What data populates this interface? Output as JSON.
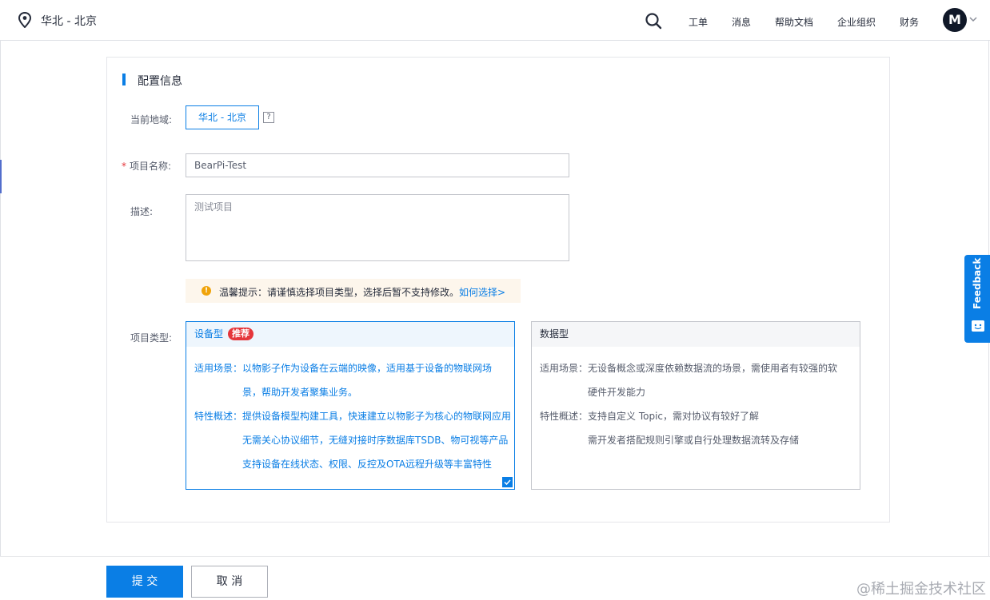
{
  "header": {
    "region": "华北 - 北京",
    "nav": [
      "工单",
      "消息",
      "帮助文档",
      "企业组织",
      "财务"
    ],
    "avatar_letter": "M"
  },
  "form": {
    "section_title": "配置信息",
    "region_label": "当前地域:",
    "region_value": "华北 - 北京",
    "help_mark": "?",
    "name_required_mark": "*",
    "name_label": "项目名称:",
    "name_value": "BearPi-Test",
    "desc_label": "描述:",
    "desc_value": "测试项目",
    "tip_text": "温馨提示：请谨慎选择项目类型，选择后暂不支持修改。",
    "tip_link": "如何选择>",
    "type_label": "项目类型:"
  },
  "types": [
    {
      "title": "设备型",
      "badge": "推荐",
      "selected": true,
      "lines": [
        "适用场景：以物影子作为设备在云端的映像，适用基于设备的物联网场",
        "景，帮助开发者聚集业务。",
        "特性概述：提供设备模型构建工具，快速建立以物影子为核心的物联网应用",
        "无需关心协议细节，无缝对接时序数据库TSDB、物可视等产品",
        "支持设备在线状态、权限、反控及OTA远程升级等丰富特性"
      ]
    },
    {
      "title": "数据型",
      "badge": "",
      "selected": false,
      "lines": [
        "适用场景：无设备概念或深度依赖数据流的场景，需使用者有较强的软",
        "硬件开发能力",
        "特性概述：支持自定义 Topic，需对协议有较好了解",
        "需开发者搭配规则引擎或自行处理数据流转及存储"
      ]
    }
  ],
  "footer": {
    "submit": "提 交",
    "cancel": "取 消",
    "watermark": "@稀土掘金技术社区"
  },
  "feedback": "Feedback",
  "colors": {
    "primary": "#0a7ee5",
    "badge": "#e5363b",
    "warning": "#f0a30a"
  },
  "icons": [
    "location-pin-icon",
    "search-icon",
    "chevron-down-icon",
    "help-icon",
    "warning-icon",
    "check-icon",
    "feedback-icon"
  ]
}
